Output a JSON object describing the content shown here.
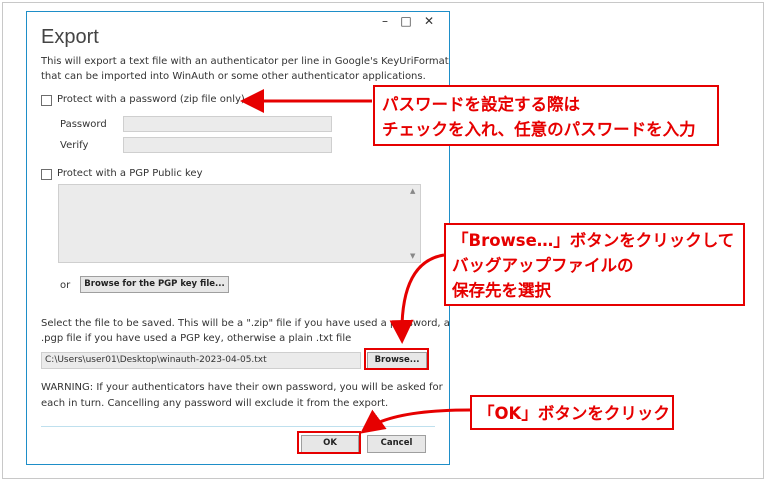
{
  "window": {
    "minimize_icon": "–",
    "maximize_icon": "□",
    "close_icon": "✕",
    "title": "Export",
    "description_line1": "This will export a text file with an authenticator per line in Google's KeyUriFormat",
    "description_line2": "that can be imported into WinAuth or some other authenticator applications."
  },
  "password_option": {
    "checkbox_label": "Protect with a password (zip file only)",
    "password_label": "Password",
    "verify_label": "Verify"
  },
  "pgp_option": {
    "checkbox_label": "Protect with a PGP Public key",
    "or_label": "or",
    "browse_key_button": "Browse for the PGP key file..."
  },
  "save": {
    "info_line1": "Select the file to be saved. This will be a \".zip\" file if you have used a password, a",
    "info_line2": ".pgp file if you have used a PGP key, otherwise a plain .txt file",
    "file_path": "C:\\Users\\user01\\Desktop\\winauth-2023-04-05.txt",
    "browse_button": "Browse..."
  },
  "warning": {
    "line1": "WARNING: If your authenticators have their own password, you will be asked for",
    "line2": "each in turn. Cancelling any password will exclude it from the export."
  },
  "buttons": {
    "ok": "OK",
    "cancel": "Cancel"
  },
  "callouts": {
    "password": [
      "パスワードを設定する際は",
      "チェックを入れ、任意のパスワードを入力"
    ],
    "browse": [
      "「Browse…」ボタンをクリックして",
      "バッグアップファイルの",
      "保存先を選択"
    ],
    "ok": [
      "「OK」ボタンをクリック"
    ]
  },
  "colors": {
    "annotation_red": "#e60000",
    "window_border": "#1e8ec8"
  }
}
